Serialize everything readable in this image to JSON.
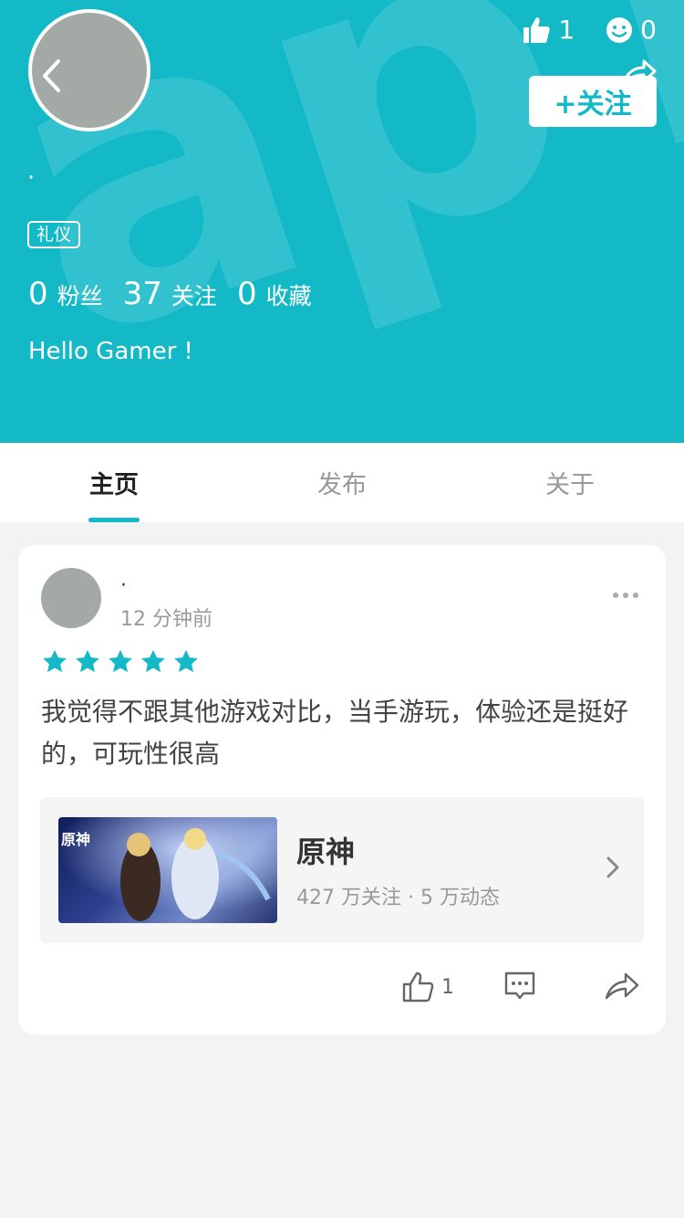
{
  "header": {
    "bg_color": "#14b9c8",
    "watermark": "apTa",
    "username": "·",
    "badge": "礼仪",
    "top_likes": "1",
    "top_smiles": "0",
    "follow_label": "+关注",
    "counts": [
      {
        "num": "0",
        "label": "粉丝"
      },
      {
        "num": "37",
        "label": "关注"
      },
      {
        "num": "0",
        "label": "收藏"
      }
    ],
    "bio": "Hello Gamer !"
  },
  "tabs": [
    {
      "label": "主页",
      "active": true
    },
    {
      "label": "发布",
      "active": false
    },
    {
      "label": "关于",
      "active": false
    }
  ],
  "post": {
    "username": "·",
    "time": "12 分钟前",
    "rating": 5,
    "text": "我觉得不跟其他游戏对比，当手游玩，体验还是挺好的，可玩性很高",
    "game": {
      "name": "原神",
      "meta": "427 万关注 · 5 万动态",
      "logo_text": "原神"
    },
    "likes": "1"
  },
  "accent": "#14b9c8"
}
